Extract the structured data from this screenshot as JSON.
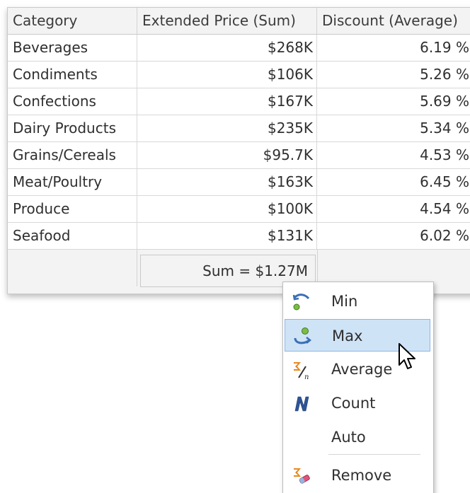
{
  "grid": {
    "columns": [
      "Category",
      "Extended Price (Sum)",
      "Discount (Average)"
    ],
    "rows": [
      {
        "category": "Beverages",
        "price": "$268K",
        "discount": "6.19 %"
      },
      {
        "category": "Condiments",
        "price": "$106K",
        "discount": "5.26 %"
      },
      {
        "category": "Confections",
        "price": "$167K",
        "discount": "5.69 %"
      },
      {
        "category": "Dairy Products",
        "price": "$235K",
        "discount": "5.34 %"
      },
      {
        "category": "Grains/Cereals",
        "price": "$95.7K",
        "discount": "4.53 %"
      },
      {
        "category": "Meat/Poultry",
        "price": "$163K",
        "discount": "6.45 %"
      },
      {
        "category": "Produce",
        "price": "$100K",
        "discount": "4.54 %"
      },
      {
        "category": "Seafood",
        "price": "$131K",
        "discount": "6.02 %"
      }
    ],
    "summary": "Sum = $1.27M"
  },
  "context_menu": {
    "items": [
      {
        "label": "Min",
        "icon": "min-icon",
        "highlighted": false
      },
      {
        "label": "Max",
        "icon": "max-icon",
        "highlighted": true
      },
      {
        "label": "Average",
        "icon": "average-icon",
        "highlighted": false
      },
      {
        "label": "Count",
        "icon": "count-icon",
        "highlighted": false
      },
      {
        "label": "Auto",
        "icon": "",
        "highlighted": false
      },
      {
        "label": "Remove",
        "icon": "remove-icon",
        "highlighted": false
      }
    ]
  },
  "colors": {
    "highlight_bg": "#cfe3f7",
    "highlight_border": "#8fb6e2",
    "header_bg": "#f3f3f3",
    "grid_line": "#d8d8d8"
  }
}
